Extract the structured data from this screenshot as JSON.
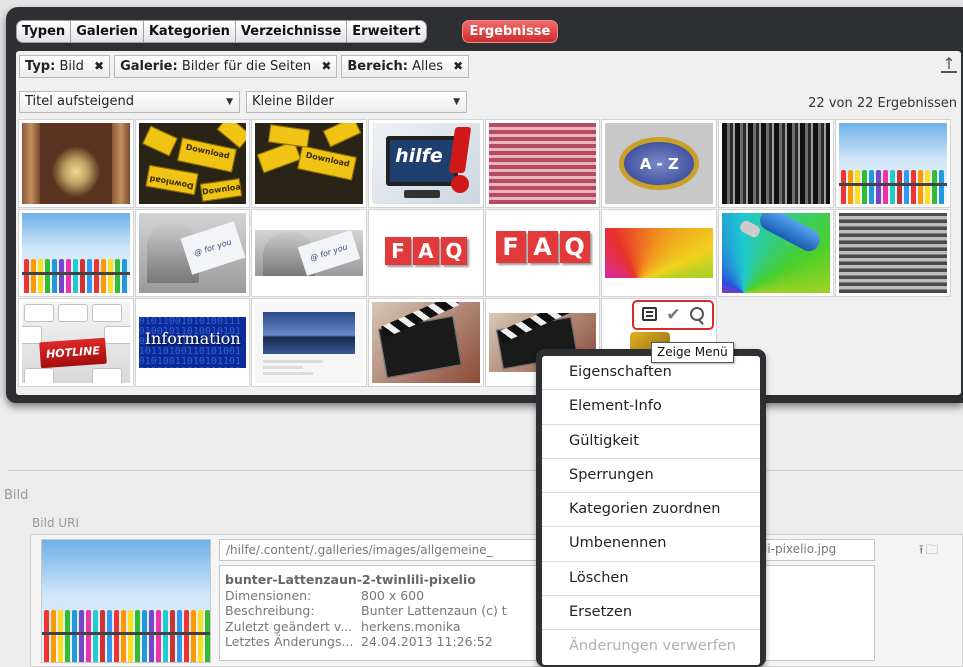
{
  "tabs": [
    "Typen",
    "Galerien",
    "Kategorien",
    "Verzeichnisse",
    "Erweitert"
  ],
  "results_tab": "Ergebnisse",
  "filters": [
    {
      "label": "Typ:",
      "value": "Bild"
    },
    {
      "label": "Galerie:",
      "value": "Bilder für die Seiten"
    },
    {
      "label": "Bereich:",
      "value": "Alles"
    }
  ],
  "remove_glyph": "✖",
  "sort_select": "Titel aufsteigend",
  "view_select": "Kleine Bilder",
  "result_count": "22 von 22 Ergebnissen",
  "thumbnails": {
    "download_sign": "Download",
    "az_label": "A - Z",
    "hilfe_label": "hilfe",
    "card_text": "@ for you",
    "faq_letters": [
      "F",
      "A",
      "Q"
    ],
    "hotline_label": "HOTLINE",
    "information_label": "Information",
    "binary_text": "0101100101010011101001011010010101001101010110100101011010011010100101010011010101101001010110100110101001"
  },
  "tooltip": "Zeige Menü",
  "context_menu": {
    "items": [
      {
        "label": "Eigenschaften",
        "enabled": true
      },
      {
        "label": "Element-Info",
        "enabled": true
      },
      {
        "label": "Gültigkeit",
        "enabled": true
      },
      {
        "label": "Sperrungen",
        "enabled": true
      },
      {
        "label": "Kategorien zuordnen",
        "enabled": true
      },
      {
        "label": "Umbenennen",
        "enabled": true
      },
      {
        "label": "Löschen",
        "enabled": true
      },
      {
        "label": "Ersetzen",
        "enabled": true
      },
      {
        "label": "Änderungen verwerfen",
        "enabled": false
      }
    ]
  },
  "editor": {
    "section_label": "Bild",
    "uri_label": "Bild URI",
    "uri_value": "/hilfe/.content/.galleries/images/allgemeine_",
    "uri_value_end": "li-pixelio.jpg",
    "file_name": "bunter-Lattenzaun-2-twinlili-pixelio",
    "dimensions_label": "Dimensionen:",
    "dimensions_value": "800 x 600",
    "description_label": "Beschreibung:",
    "description_value": "Bunter Lattenzaun (c) t",
    "modified_by_label": "Zuletzt geändert v...",
    "modified_by_value": "herkens.monika",
    "last_change_label": "Letztes Änderungs...",
    "last_change_value": "24.04.2013 11:26:52"
  },
  "colors": {
    "dialog_bg": "#2d2f33",
    "results_tab": "#cc2d2d",
    "highlight_border": "#d92a2a"
  }
}
